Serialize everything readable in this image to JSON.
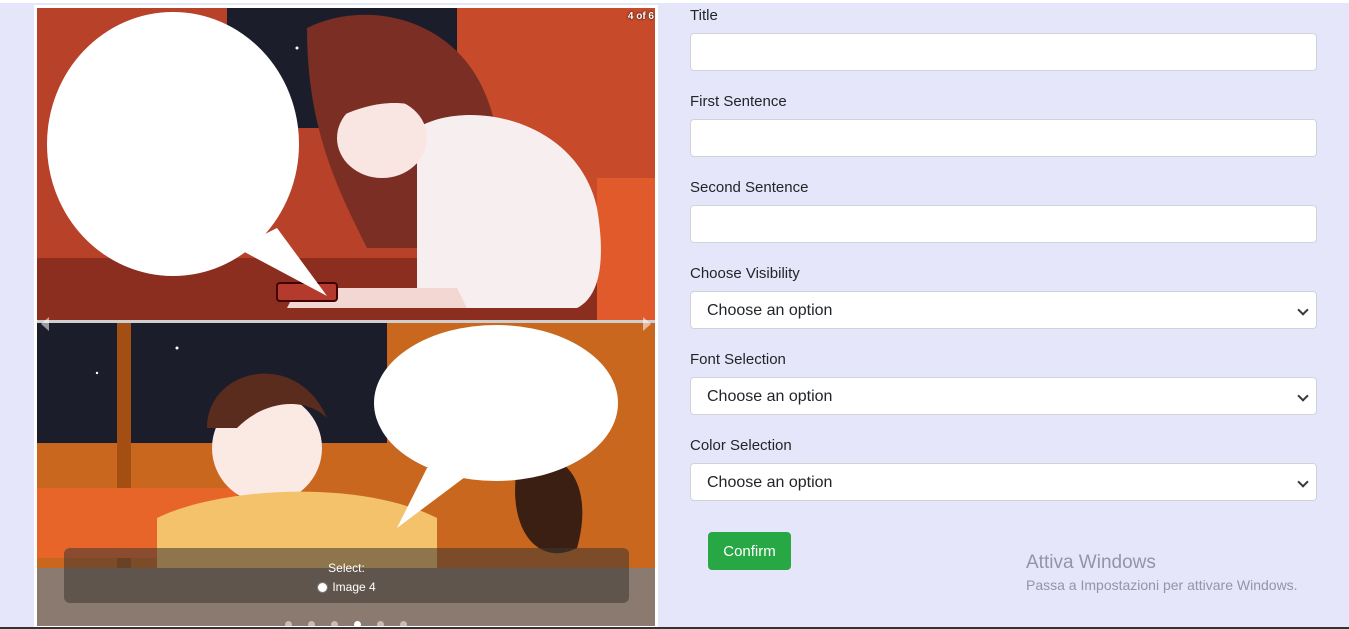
{
  "carousel": {
    "counter": "4 of 6",
    "caption_title": "Select:",
    "radio_label": "Image 4",
    "total_slides": 6,
    "active_slide": 4
  },
  "form": {
    "title_label": "Title",
    "title_value": "",
    "first_label": "First Sentence",
    "first_value": "",
    "second_label": "Second Sentence",
    "second_value": "",
    "visibility_label": "Choose Visibility",
    "visibility_selected": "Choose an option",
    "font_label": "Font Selection",
    "font_selected": "Choose an option",
    "color_label": "Color Selection",
    "color_selected": "Choose an option",
    "confirm_label": "Confirm"
  },
  "watermark": {
    "title": "Attiva Windows",
    "subtitle": "Passa a Impostazioni per attivare Windows."
  },
  "colors": {
    "page_bg": "#e6e6fa",
    "confirm_bg": "#28a745",
    "border": "#ced4da"
  }
}
